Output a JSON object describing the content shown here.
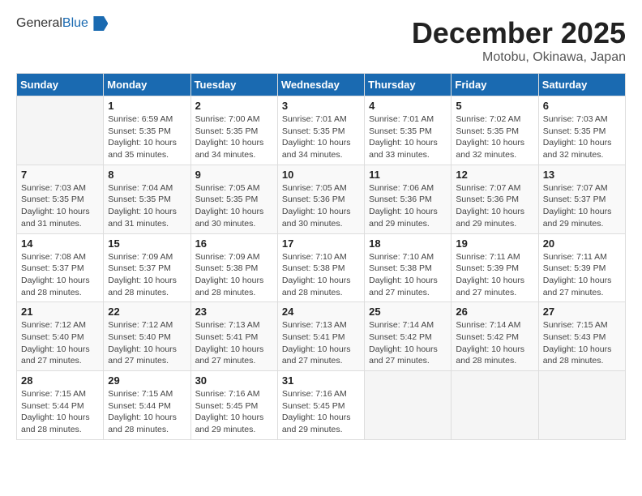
{
  "header": {
    "logo_general": "General",
    "logo_blue": "Blue",
    "month_title": "December 2025",
    "location": "Motobu, Okinawa, Japan"
  },
  "weekdays": [
    "Sunday",
    "Monday",
    "Tuesday",
    "Wednesday",
    "Thursday",
    "Friday",
    "Saturday"
  ],
  "weeks": [
    [
      {
        "day": "",
        "info": ""
      },
      {
        "day": "1",
        "info": "Sunrise: 6:59 AM\nSunset: 5:35 PM\nDaylight: 10 hours\nand 35 minutes."
      },
      {
        "day": "2",
        "info": "Sunrise: 7:00 AM\nSunset: 5:35 PM\nDaylight: 10 hours\nand 34 minutes."
      },
      {
        "day": "3",
        "info": "Sunrise: 7:01 AM\nSunset: 5:35 PM\nDaylight: 10 hours\nand 34 minutes."
      },
      {
        "day": "4",
        "info": "Sunrise: 7:01 AM\nSunset: 5:35 PM\nDaylight: 10 hours\nand 33 minutes."
      },
      {
        "day": "5",
        "info": "Sunrise: 7:02 AM\nSunset: 5:35 PM\nDaylight: 10 hours\nand 32 minutes."
      },
      {
        "day": "6",
        "info": "Sunrise: 7:03 AM\nSunset: 5:35 PM\nDaylight: 10 hours\nand 32 minutes."
      }
    ],
    [
      {
        "day": "7",
        "info": "Sunrise: 7:03 AM\nSunset: 5:35 PM\nDaylight: 10 hours\nand 31 minutes."
      },
      {
        "day": "8",
        "info": "Sunrise: 7:04 AM\nSunset: 5:35 PM\nDaylight: 10 hours\nand 31 minutes."
      },
      {
        "day": "9",
        "info": "Sunrise: 7:05 AM\nSunset: 5:35 PM\nDaylight: 10 hours\nand 30 minutes."
      },
      {
        "day": "10",
        "info": "Sunrise: 7:05 AM\nSunset: 5:36 PM\nDaylight: 10 hours\nand 30 minutes."
      },
      {
        "day": "11",
        "info": "Sunrise: 7:06 AM\nSunset: 5:36 PM\nDaylight: 10 hours\nand 29 minutes."
      },
      {
        "day": "12",
        "info": "Sunrise: 7:07 AM\nSunset: 5:36 PM\nDaylight: 10 hours\nand 29 minutes."
      },
      {
        "day": "13",
        "info": "Sunrise: 7:07 AM\nSunset: 5:37 PM\nDaylight: 10 hours\nand 29 minutes."
      }
    ],
    [
      {
        "day": "14",
        "info": "Sunrise: 7:08 AM\nSunset: 5:37 PM\nDaylight: 10 hours\nand 28 minutes."
      },
      {
        "day": "15",
        "info": "Sunrise: 7:09 AM\nSunset: 5:37 PM\nDaylight: 10 hours\nand 28 minutes."
      },
      {
        "day": "16",
        "info": "Sunrise: 7:09 AM\nSunset: 5:38 PM\nDaylight: 10 hours\nand 28 minutes."
      },
      {
        "day": "17",
        "info": "Sunrise: 7:10 AM\nSunset: 5:38 PM\nDaylight: 10 hours\nand 28 minutes."
      },
      {
        "day": "18",
        "info": "Sunrise: 7:10 AM\nSunset: 5:38 PM\nDaylight: 10 hours\nand 27 minutes."
      },
      {
        "day": "19",
        "info": "Sunrise: 7:11 AM\nSunset: 5:39 PM\nDaylight: 10 hours\nand 27 minutes."
      },
      {
        "day": "20",
        "info": "Sunrise: 7:11 AM\nSunset: 5:39 PM\nDaylight: 10 hours\nand 27 minutes."
      }
    ],
    [
      {
        "day": "21",
        "info": "Sunrise: 7:12 AM\nSunset: 5:40 PM\nDaylight: 10 hours\nand 27 minutes."
      },
      {
        "day": "22",
        "info": "Sunrise: 7:12 AM\nSunset: 5:40 PM\nDaylight: 10 hours\nand 27 minutes."
      },
      {
        "day": "23",
        "info": "Sunrise: 7:13 AM\nSunset: 5:41 PM\nDaylight: 10 hours\nand 27 minutes."
      },
      {
        "day": "24",
        "info": "Sunrise: 7:13 AM\nSunset: 5:41 PM\nDaylight: 10 hours\nand 27 minutes."
      },
      {
        "day": "25",
        "info": "Sunrise: 7:14 AM\nSunset: 5:42 PM\nDaylight: 10 hours\nand 27 minutes."
      },
      {
        "day": "26",
        "info": "Sunrise: 7:14 AM\nSunset: 5:42 PM\nDaylight: 10 hours\nand 28 minutes."
      },
      {
        "day": "27",
        "info": "Sunrise: 7:15 AM\nSunset: 5:43 PM\nDaylight: 10 hours\nand 28 minutes."
      }
    ],
    [
      {
        "day": "28",
        "info": "Sunrise: 7:15 AM\nSunset: 5:44 PM\nDaylight: 10 hours\nand 28 minutes."
      },
      {
        "day": "29",
        "info": "Sunrise: 7:15 AM\nSunset: 5:44 PM\nDaylight: 10 hours\nand 28 minutes."
      },
      {
        "day": "30",
        "info": "Sunrise: 7:16 AM\nSunset: 5:45 PM\nDaylight: 10 hours\nand 29 minutes."
      },
      {
        "day": "31",
        "info": "Sunrise: 7:16 AM\nSunset: 5:45 PM\nDaylight: 10 hours\nand 29 minutes."
      },
      {
        "day": "",
        "info": ""
      },
      {
        "day": "",
        "info": ""
      },
      {
        "day": "",
        "info": ""
      }
    ]
  ]
}
